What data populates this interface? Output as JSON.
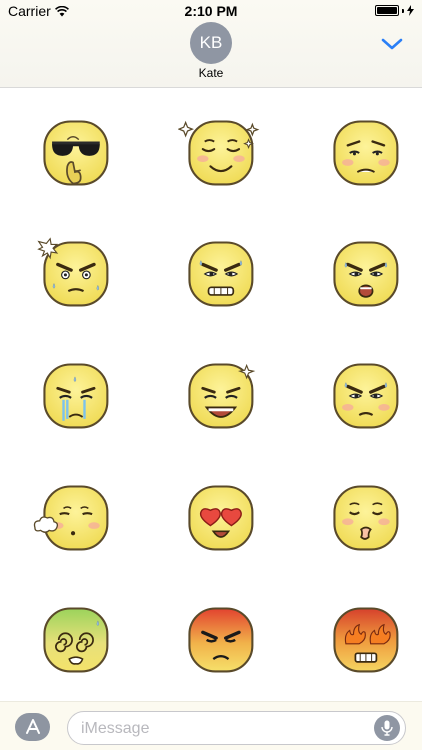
{
  "status_bar": {
    "carrier": "Carrier",
    "time": "2:10 PM",
    "battery_level": 1.0
  },
  "contact": {
    "initials": "KB",
    "name": "Kate"
  },
  "colors": {
    "accent": "#2a7ff6",
    "avatar": "#8f96a3",
    "face": "#f7e66a",
    "outline": "#5a4a2a"
  },
  "icons": {
    "collapse": "chevron-down-icon",
    "app_store": "app-store-icon",
    "mic": "microphone-icon",
    "wifi": "wifi-icon",
    "battery": "battery-icon"
  },
  "stickers": [
    "sunglasses-shush-face",
    "blissful-sparkle-face",
    "worried-blush-face",
    "shocked-face",
    "angry-gritted-teeth-face",
    "angry-shouting-face",
    "crying-face",
    "laughing-face",
    "angry-blush-face",
    "sighing-face",
    "heart-eyes-face",
    "kissing-blush-face",
    "dizzy-sick-face",
    "angry-red-face",
    "fiery-rage-face"
  ],
  "input": {
    "placeholder": "iMessage"
  }
}
